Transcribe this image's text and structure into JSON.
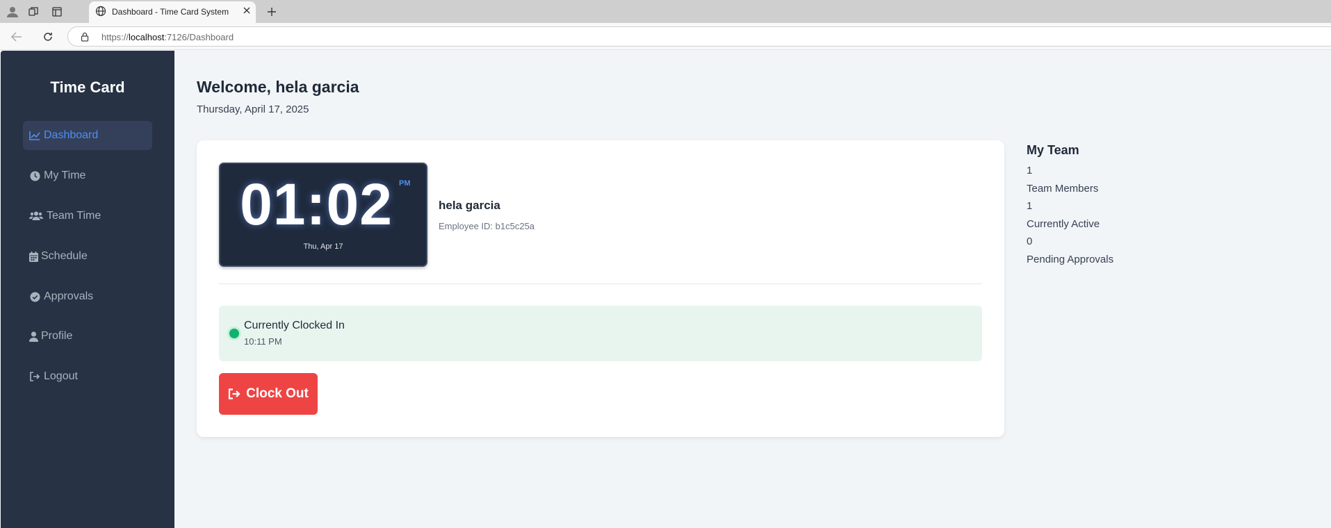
{
  "browser": {
    "tab_title": "Dashboard - Time Card System",
    "url_prefix": "https://",
    "url_host": "localhost",
    "url_rest": ":7126/Dashboard"
  },
  "sidebar": {
    "brand": "Time Card",
    "items": [
      {
        "label": "Dashboard",
        "icon": "chart-line-icon"
      },
      {
        "label": "My Time",
        "icon": "clock-icon"
      },
      {
        "label": "Team Time",
        "icon": "users-icon"
      },
      {
        "label": "Schedule",
        "icon": "calendar-icon"
      },
      {
        "label": "Approvals",
        "icon": "check-circle-icon"
      },
      {
        "label": "Profile",
        "icon": "user-icon"
      },
      {
        "label": "Logout",
        "icon": "logout-icon"
      }
    ]
  },
  "header": {
    "welcome": "Welcome, hela garcia",
    "date": "Thursday, April 17, 2025"
  },
  "clock": {
    "time": "01:02",
    "ampm": "PM",
    "date": "Thu, Apr 17"
  },
  "employee": {
    "name": "hela garcia",
    "id_label": "Employee ID: b1c5c25a"
  },
  "status": {
    "label": "Currently Clocked In",
    "time": "10:11 PM",
    "color": "#10b270"
  },
  "actions": {
    "clock_out": "Clock Out",
    "color": "#ef4444"
  },
  "team": {
    "title": "My Team",
    "stats": [
      {
        "value": "1",
        "label": "Team Members"
      },
      {
        "value": "1",
        "label": "Currently Active"
      },
      {
        "value": "0",
        "label": "Pending Approvals"
      }
    ]
  }
}
